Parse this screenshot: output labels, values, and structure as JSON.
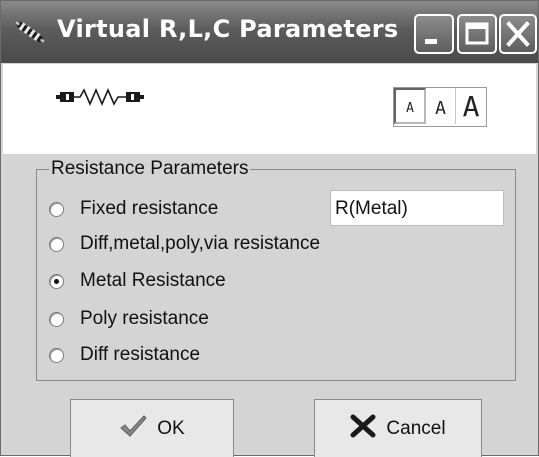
{
  "window": {
    "title": "Virtual R,L,C Parameters",
    "icons": {
      "app": "cable-icon",
      "minimize": "minimize-icon",
      "maximize": "maximize-icon",
      "close": "close-icon"
    }
  },
  "toolbar": {
    "component_icon": "resistor-icon",
    "font_sizes": [
      {
        "label": "A",
        "size": "small",
        "selected": true
      },
      {
        "label": "A",
        "size": "medium",
        "selected": false
      },
      {
        "label": "A",
        "size": "large",
        "selected": false
      }
    ]
  },
  "resistance": {
    "group_title": "Resistance Parameters",
    "value": "R(Metal)",
    "options": [
      {
        "label": "Fixed resistance",
        "checked": false
      },
      {
        "label": "Diff,metal,poly,via resistance",
        "checked": false
      },
      {
        "label": "Metal Resistance",
        "checked": true
      },
      {
        "label": "Poly resistance",
        "checked": false
      },
      {
        "label": "Diff resistance",
        "checked": false
      }
    ]
  },
  "buttons": {
    "ok_label": "OK",
    "ok_icon": "checkmark-icon",
    "cancel_label": "Cancel",
    "cancel_icon": "x-icon"
  },
  "colors": {
    "titlebar": "#5c5c5c",
    "dialog_bg": "#d4d4d4",
    "content_bg": "#ffffff"
  }
}
